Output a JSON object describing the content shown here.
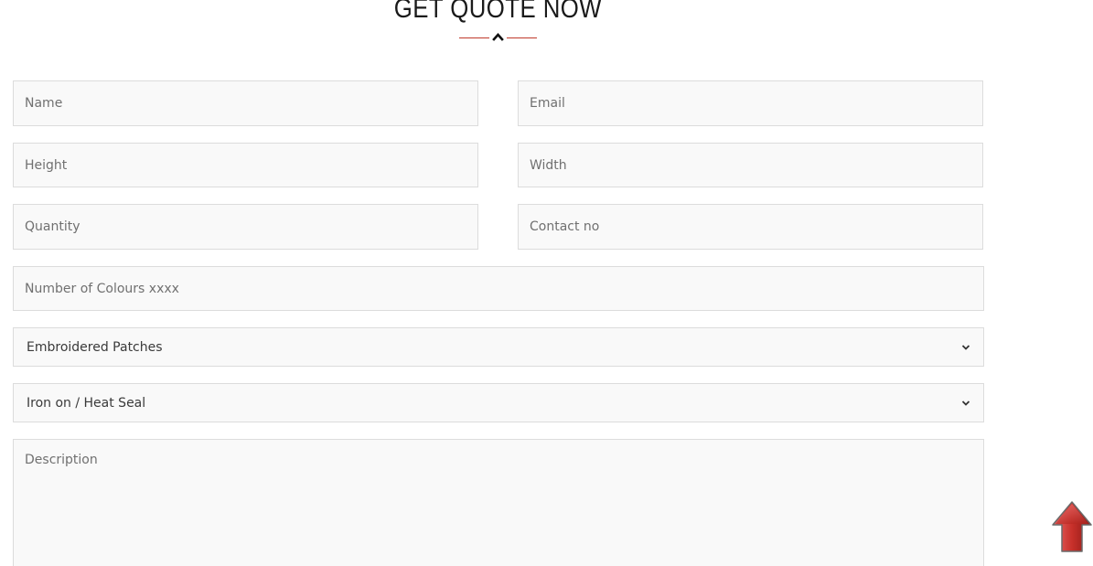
{
  "header": {
    "title": "GET QUOTE NOW"
  },
  "form": {
    "name_placeholder": "Name",
    "email_placeholder": "Email",
    "height_placeholder": "Height",
    "width_placeholder": "Width",
    "quantity_placeholder": "Quantity",
    "contact_placeholder": "Contact no",
    "colours_placeholder": "Number of Colours xxxx",
    "patch_type_selected": "Embroidered Patches",
    "backing_selected": "Iron on / Heat Seal",
    "description_placeholder": "Description"
  },
  "icons": {
    "divider": "chevron-up-icon",
    "select_arrow": "chevron-down-icon",
    "scroll_top": "red-arrow-up-icon"
  },
  "colors": {
    "accent": "#c0392b",
    "field_bg": "#f9f9f9",
    "field_border": "#dcdcdc",
    "title": "#1a1a1a"
  }
}
